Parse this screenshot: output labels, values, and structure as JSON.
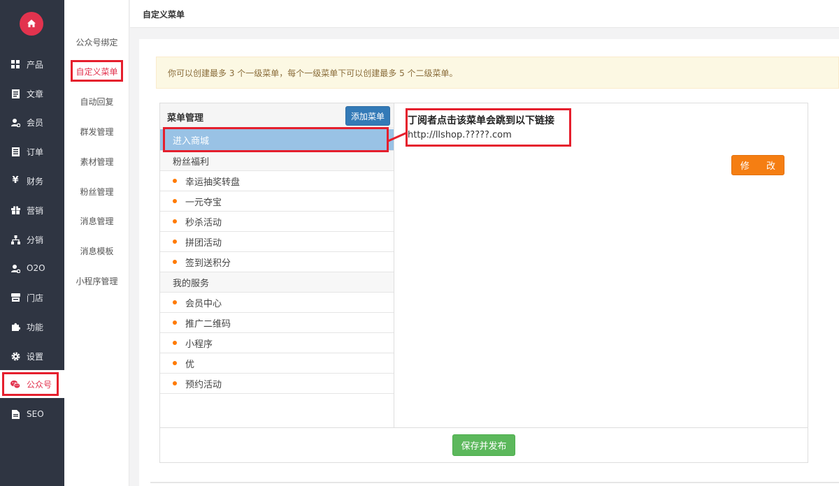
{
  "sidebar": {
    "items": [
      {
        "label": "产品",
        "icon": "grid-icon"
      },
      {
        "label": "文章",
        "icon": "document-icon"
      },
      {
        "label": "会员",
        "icon": "member-icon"
      },
      {
        "label": "订单",
        "icon": "list-icon"
      },
      {
        "label": "财务",
        "icon": "yen-icon"
      },
      {
        "label": "营销",
        "icon": "gift-icon"
      },
      {
        "label": "分销",
        "icon": "sitemap-icon"
      },
      {
        "label": "O2O",
        "icon": "users-icon"
      },
      {
        "label": "门店",
        "icon": "store-icon"
      },
      {
        "label": "功能",
        "icon": "puzzle-icon"
      },
      {
        "label": "设置",
        "icon": "gear-icon"
      },
      {
        "label": "公众号",
        "icon": "wechat-icon"
      },
      {
        "label": "SEO",
        "icon": "file-icon"
      }
    ],
    "active_index": 11
  },
  "subnav": {
    "items": [
      "公众号绑定",
      "自定义菜单",
      "自动回复",
      "群发管理",
      "素材管理",
      "粉丝管理",
      "消息管理",
      "消息模板",
      "小程序管理"
    ],
    "active_index": 1
  },
  "topbar": {
    "title": "自定义菜单"
  },
  "notice": "你可以创建最多 3 个一级菜单，每个一级菜单下可以创建最多 5 个二级菜单。",
  "menu": {
    "header": "菜单管理",
    "add_button": "添加菜单",
    "rows": [
      {
        "label": "进入商城",
        "level": 1,
        "selected": true
      },
      {
        "label": "粉丝福利",
        "level": 1
      },
      {
        "label": "幸运抽奖转盘",
        "level": 2
      },
      {
        "label": "一元夺宝",
        "level": 2
      },
      {
        "label": "秒杀活动",
        "level": 2
      },
      {
        "label": "拼团活动",
        "level": 2
      },
      {
        "label": "签到送积分",
        "level": 2
      },
      {
        "label": "我的服务",
        "level": 1
      },
      {
        "label": "会员中心",
        "level": 2
      },
      {
        "label": "推广二维码",
        "level": 2
      },
      {
        "label": "小程序",
        "level": 2
      },
      {
        "label": "优",
        "level": 2
      },
      {
        "label": "预约活动",
        "level": 2
      }
    ]
  },
  "detail": {
    "heading": "丁阅者点击该菜单会跳到以下链接",
    "url": "http://llshop.?????.com",
    "edit_button": "修 改"
  },
  "footer": {
    "save_button": "保存并发布"
  },
  "colors": {
    "sidebar_bg": "#2f3542",
    "brand_red": "#e2334e",
    "annotation_red": "#e51f2d",
    "primary_blue": "#337ab7",
    "selected_row": "#99c2e5",
    "edit_orange": "#f57e12",
    "save_green": "#5cb85c",
    "bullet_orange": "#ff7a00"
  }
}
